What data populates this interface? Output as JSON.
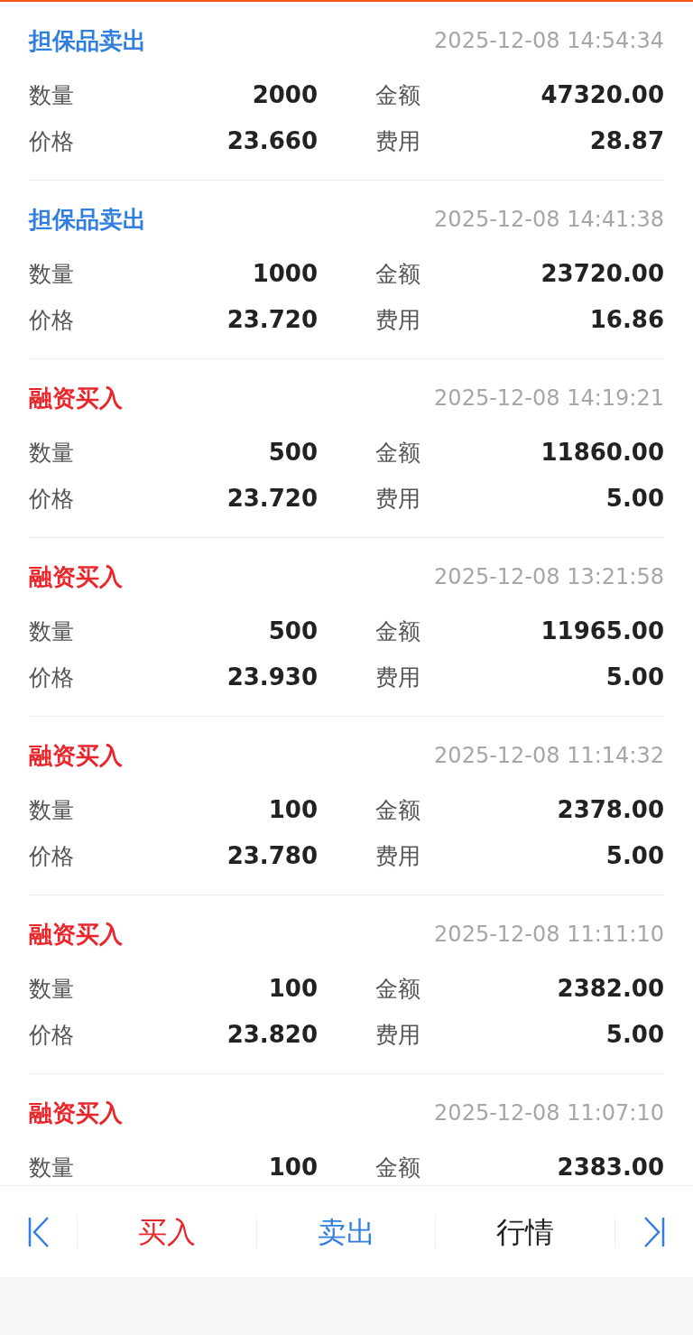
{
  "records": [
    {
      "kind": "sell",
      "type": "担保品卖出",
      "time": "2025-12-08 14:54:34",
      "fields": [
        {
          "label": "数量",
          "value": "2000"
        },
        {
          "label": "金额",
          "value": "47320.00"
        },
        {
          "label": "价格",
          "value": "23.660"
        },
        {
          "label": "费用",
          "value": "28.87"
        }
      ]
    },
    {
      "kind": "sell",
      "type": "担保品卖出",
      "time": "2025-12-08 14:41:38",
      "fields": [
        {
          "label": "数量",
          "value": "1000"
        },
        {
          "label": "金额",
          "value": "23720.00"
        },
        {
          "label": "价格",
          "value": "23.720"
        },
        {
          "label": "费用",
          "value": "16.86"
        }
      ]
    },
    {
      "kind": "buy",
      "type": "融资买入",
      "time": "2025-12-08 14:19:21",
      "fields": [
        {
          "label": "数量",
          "value": "500"
        },
        {
          "label": "金额",
          "value": "11860.00"
        },
        {
          "label": "价格",
          "value": "23.720"
        },
        {
          "label": "费用",
          "value": "5.00"
        }
      ]
    },
    {
      "kind": "buy",
      "type": "融资买入",
      "time": "2025-12-08 13:21:58",
      "fields": [
        {
          "label": "数量",
          "value": "500"
        },
        {
          "label": "金额",
          "value": "11965.00"
        },
        {
          "label": "价格",
          "value": "23.930"
        },
        {
          "label": "费用",
          "value": "5.00"
        }
      ]
    },
    {
      "kind": "buy",
      "type": "融资买入",
      "time": "2025-12-08 11:14:32",
      "fields": [
        {
          "label": "数量",
          "value": "100"
        },
        {
          "label": "金额",
          "value": "2378.00"
        },
        {
          "label": "价格",
          "value": "23.780"
        },
        {
          "label": "费用",
          "value": "5.00"
        }
      ]
    },
    {
      "kind": "buy",
      "type": "融资买入",
      "time": "2025-12-08 11:11:10",
      "fields": [
        {
          "label": "数量",
          "value": "100"
        },
        {
          "label": "金额",
          "value": "2382.00"
        },
        {
          "label": "价格",
          "value": "23.820"
        },
        {
          "label": "费用",
          "value": "5.00"
        }
      ]
    },
    {
      "kind": "buy",
      "type": "融资买入",
      "time": "2025-12-08 11:07:10",
      "fields": [
        {
          "label": "数量",
          "value": "100"
        },
        {
          "label": "金额",
          "value": "2383.00"
        }
      ]
    }
  ],
  "toolbar": [
    {
      "kind": "first"
    },
    {
      "kind": "buy",
      "label": "买入"
    },
    {
      "kind": "sell",
      "label": "卖出"
    },
    {
      "kind": "quote",
      "label": "行情"
    },
    {
      "kind": "last"
    }
  ]
}
